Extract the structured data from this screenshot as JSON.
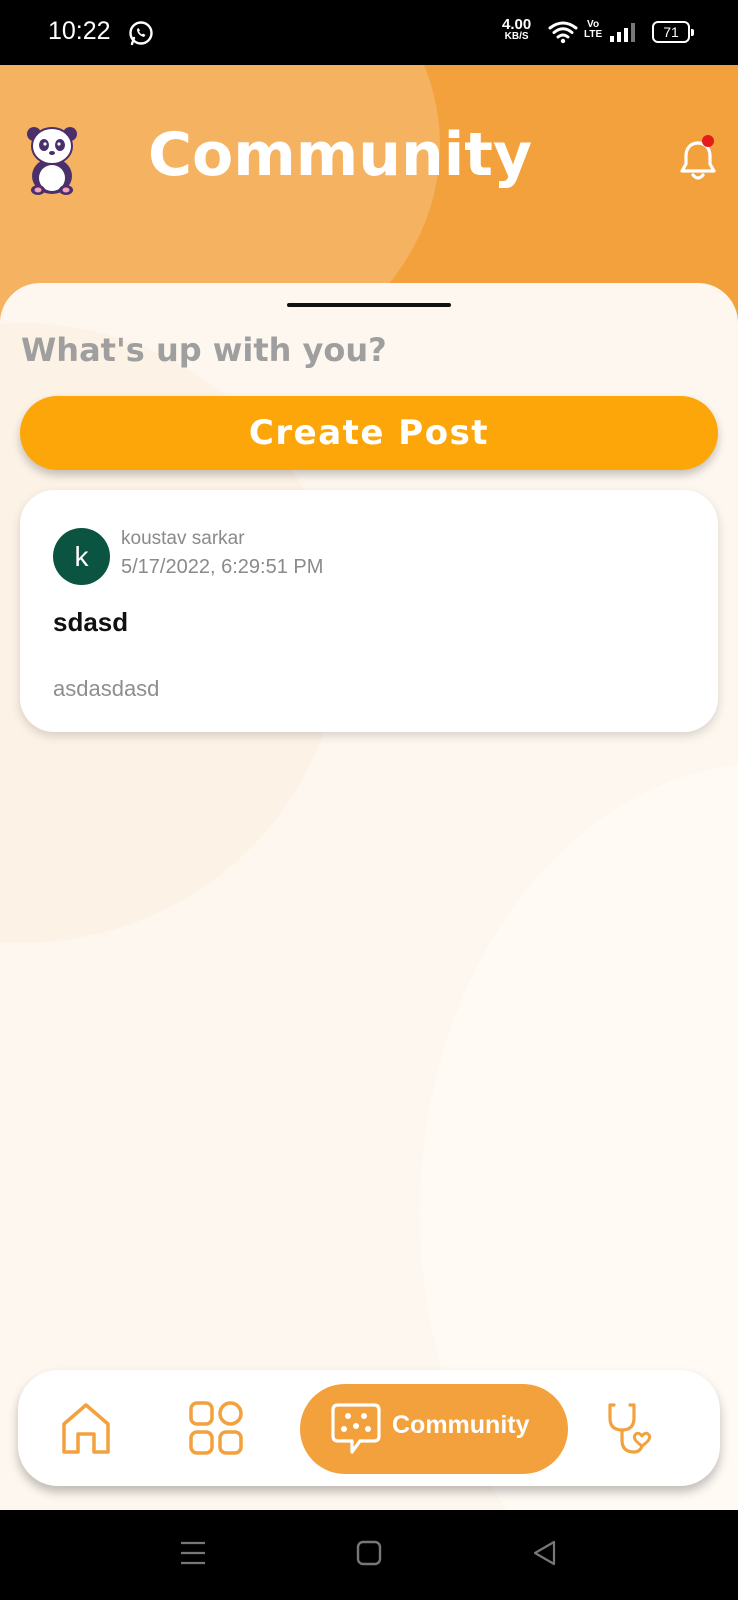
{
  "status_bar": {
    "time": "10:22",
    "net_speed_value": "4.00",
    "net_speed_unit": "KB/S",
    "volte_top": "Vo",
    "volte_bottom": "LTE",
    "battery": "71"
  },
  "header": {
    "title": "Community"
  },
  "feed": {
    "prompt": "What's up with you?",
    "create_post_label": "Create Post",
    "posts": [
      {
        "avatar_letter": "k",
        "author": "koustav sarkar",
        "timestamp": "5/17/2022, 6:29:51 PM",
        "title": "sdasd",
        "body": "asdasdasd"
      }
    ]
  },
  "bottom_nav": {
    "items": [
      {
        "icon": "home-icon",
        "label": ""
      },
      {
        "icon": "apps-grid-icon",
        "label": ""
      },
      {
        "icon": "community-chat-icon",
        "label": "Community",
        "active": true
      },
      {
        "icon": "stethoscope-icon",
        "label": ""
      }
    ]
  },
  "colors": {
    "primary_orange": "#f3a13d",
    "button_orange": "#fca60a",
    "avatar_green": "#0b5441",
    "notification_dot": "#e51b1b",
    "sheet_background": "#fdf7ef"
  }
}
